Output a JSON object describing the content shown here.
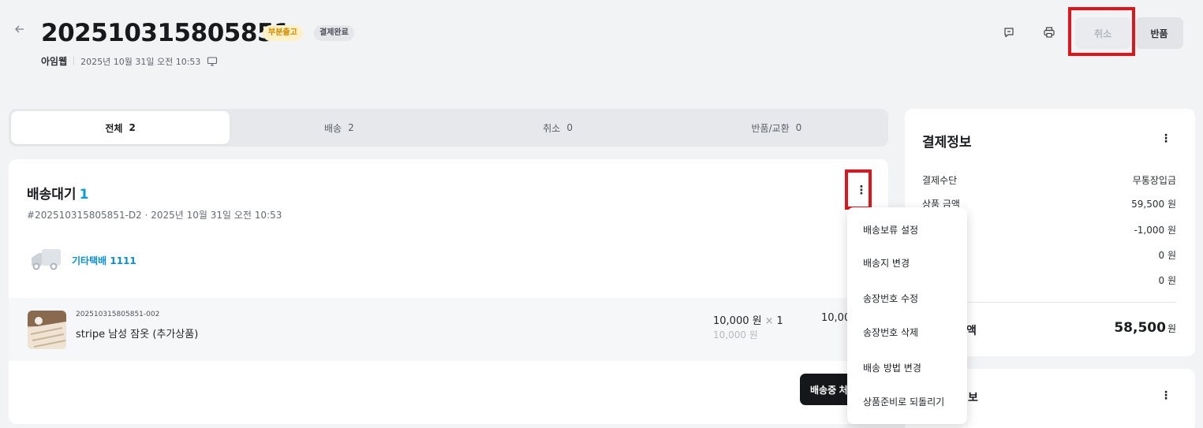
{
  "header": {
    "order_number": "202510315805851",
    "badges": [
      "부분출고",
      "결제완료"
    ],
    "shop": "아임웹",
    "ordered_at": "2025년 10월 31일 오전 10:53",
    "cancel_label": "취소",
    "return_label": "반품"
  },
  "tabs": [
    {
      "label": "전체",
      "count": "2",
      "active": true
    },
    {
      "label": "배송",
      "count": "2",
      "active": false
    },
    {
      "label": "취소",
      "count": "0",
      "active": false
    },
    {
      "label": "반품/교환",
      "count": "0",
      "active": false
    }
  ],
  "shipment": {
    "status": "배송대기",
    "count": "1",
    "meta": "#202510315805851-D2 · 2025년 10월 31일 오전 10:53",
    "carrier": "기타택배 1111",
    "item": {
      "code": "202510315805851-002",
      "name": "stripe 남성 잠옷 (추가상품)",
      "unit_price": "10,000 원",
      "quantity_mark": "×",
      "quantity": "1",
      "original_price": "10,000 원",
      "total": "10,00"
    },
    "action_label": "배송중 처"
  },
  "menu": {
    "items": [
      "배송보류 설정",
      "배송지 변경",
      "송장번호 수정",
      "송장번호 삭제",
      "배송 방법 변경",
      "상품준비로 되돌리기"
    ]
  },
  "payment": {
    "title": "결제정보",
    "rows": [
      {
        "label": "결제수단",
        "value": "무통장입금"
      },
      {
        "label": "상품 금액",
        "value": "59,500 원"
      },
      {
        "label": "",
        "value": "-1,000 원"
      },
      {
        "label": "",
        "value": "0 원"
      },
      {
        "label": "",
        "value": "0 원"
      }
    ],
    "total_label": "액",
    "total_value": "58,500",
    "total_unit": "원"
  },
  "panel2": {
    "title": "보"
  },
  "colors": {
    "accent": "#0a9bd6",
    "highlight": "#e0141b",
    "partial_badge": "#fff1c7"
  }
}
